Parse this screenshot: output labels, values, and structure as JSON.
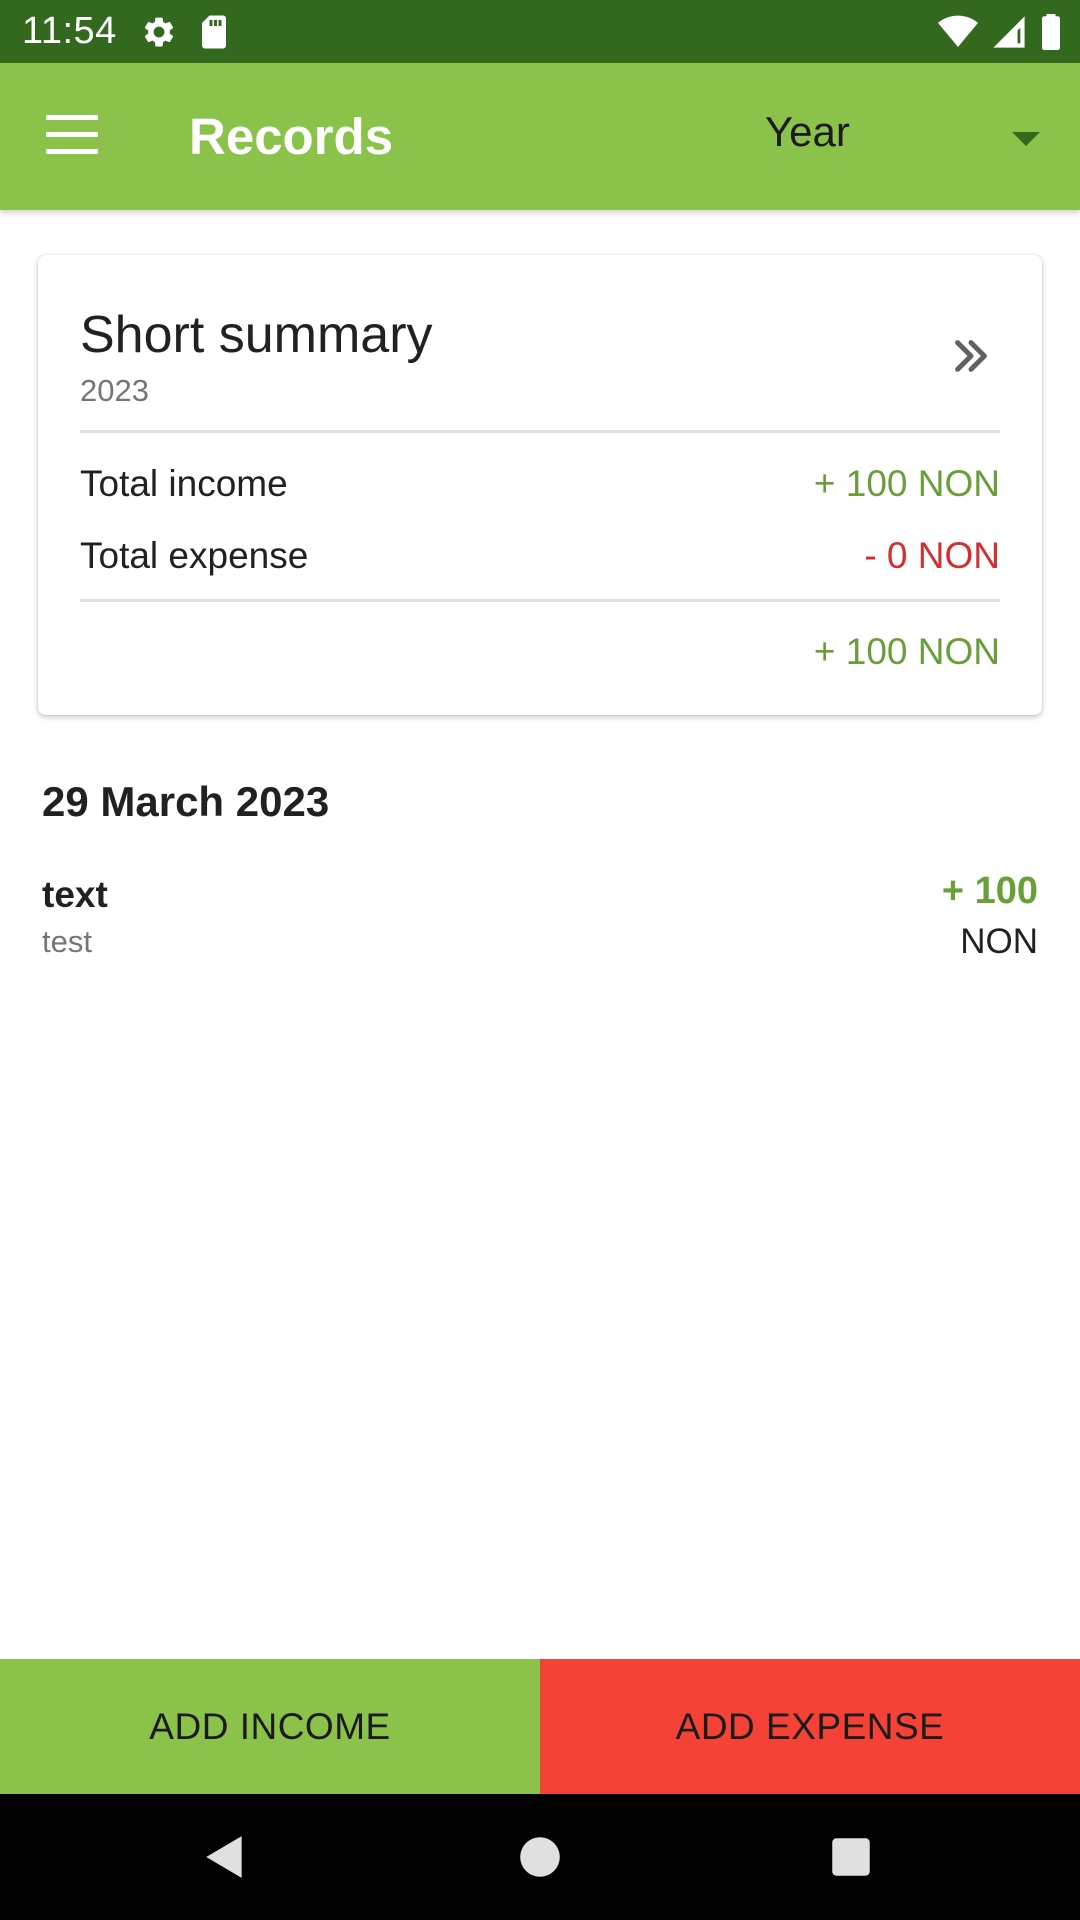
{
  "status_bar": {
    "time": "11:54",
    "left_icons": [
      "gear-icon",
      "sd-card-icon"
    ],
    "right_icons": [
      "wifi-icon",
      "signal-icon",
      "battery-icon"
    ]
  },
  "app_bar": {
    "title": "Records",
    "period_selected": "Year",
    "background_color": "#8bc34a"
  },
  "summary": {
    "title": "Short summary",
    "year": "2023",
    "income_label": "Total income",
    "income_value": "+ 100 NON",
    "expense_label": "Total expense",
    "expense_value": "- 0 NON",
    "balance_value": "+ 100 NON"
  },
  "records": {
    "date_header": "29 March 2023",
    "items": [
      {
        "name": "text",
        "note": "test",
        "amount": "+ 100",
        "currency": "NON"
      }
    ]
  },
  "actions": {
    "add_income": "ADD INCOME",
    "add_expense": "ADD EXPENSE",
    "income_color": "#8bc34a",
    "expense_color": "#f44336"
  },
  "nav_bar": {
    "buttons": [
      "back-icon",
      "home-icon",
      "recents-icon"
    ]
  }
}
